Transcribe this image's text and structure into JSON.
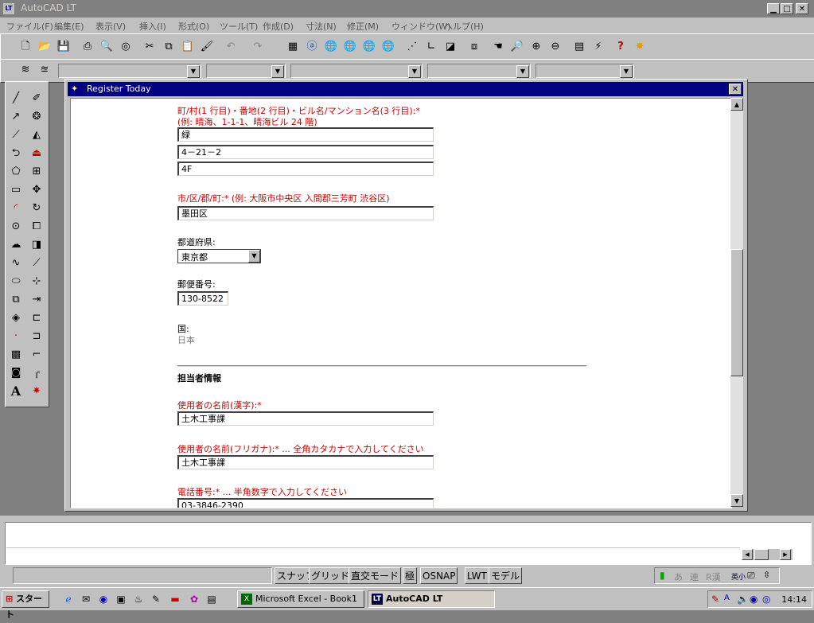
{
  "window": {
    "title": "AutoCAD LT",
    "icon_text": "LT",
    "controls": [
      "minimize-icon",
      "maximize-icon",
      "close-icon"
    ]
  },
  "menubar": {
    "items": [
      "ファイル(F)",
      "編集(E)",
      "表示(V)",
      "挿入(I)",
      "形式(O)",
      "ツール(T)",
      "作成(D)",
      "寸法(N)",
      "修正(M)",
      "ウィンドウ(W)",
      "ヘルプ(H)"
    ]
  },
  "dialog": {
    "title": "Register Today",
    "address_label": "町/村(1 行目)・番地(2 行目)・ビル名/マンション名(3 行目):*",
    "address_example": "(例: 晴海、1-1-1、晴海ビル 24 階)",
    "address_line1": "緑",
    "address_line2": "4－21－2",
    "address_line3": "4F",
    "city_label": "市/区/郡/町:* (例: 大阪市中央区 入間郡三芳町 渋谷区)",
    "city_value": "墨田区",
    "prefecture_label": "都道府県:",
    "prefecture_value": "東京都",
    "postal_label": "郵便番号:",
    "postal_value": "130-8522",
    "country_label": "国:",
    "country_value": "日本",
    "section_title": "担当者情報",
    "name_kanji_label": "使用者の名前(漢字):*",
    "name_kanji_value": "土木工事課",
    "name_kana_label": "使用者の名前(フリガナ):* ... 全角カタカナで入力してください",
    "name_kana_value": "土木工事課",
    "phone_label": "電話番号:* ... 半角数字で入力してください",
    "phone_value": "03-3846-2390"
  },
  "statusbar": {
    "buttons": [
      "スナップ",
      "グリッド",
      "直交モード",
      "極",
      "OSNAP",
      "LWT",
      "モデル"
    ],
    "ime": [
      "あ",
      "連",
      "R漢",
      "英小"
    ]
  },
  "taskbar": {
    "start_label": "スタート",
    "tasks": [
      {
        "label": "Microsoft Excel - Book1",
        "active": false
      },
      {
        "label": "AutoCAD LT",
        "active": true
      }
    ],
    "clock": "14:14"
  },
  "colors": {
    "dialog_title": "#000080",
    "required_label": "#cc0000",
    "face": "#c0c0c0"
  }
}
